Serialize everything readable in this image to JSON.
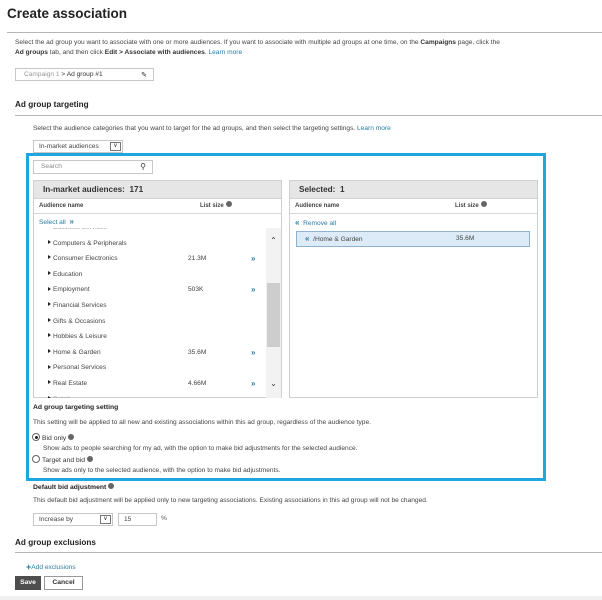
{
  "page": {
    "title": "Create association",
    "intro": {
      "part1": "Select the ad group you want to associate with one or more audiences. If you want to associate with multiple ad groups at one time, on the ",
      "campaigns": "Campaigns",
      "part2": " page, click the",
      "ad_groups": "Ad groups",
      "part3": " tab, and then click ",
      "edit_path": "Edit > Associate with audiences",
      "part4": ". ",
      "learn_more": "Learn more"
    },
    "ad_group_field": {
      "campaign": "Campaign 1",
      "separator": " > ",
      "ad_group": "Ad group #1",
      "edit_icon": "pencil-icon"
    }
  },
  "targeting": {
    "heading": "Ad group targeting",
    "description": "Select the audience categories that you want to target for the ad groups, and then select the targeting settings. ",
    "learn_more": "Learn more",
    "category_select": "In-market audiences",
    "search_placeholder": "Search",
    "available": {
      "title": "In-market audiences:",
      "count": "171",
      "col_name": "Audience name",
      "col_size": "List size",
      "select_all": "Select all",
      "partial_top": "Business Services",
      "items": [
        {
          "name": "Computers & Peripherals",
          "size": "",
          "addable": false
        },
        {
          "name": "Consumer Electronics",
          "size": "21.3M",
          "addable": true
        },
        {
          "name": "Education",
          "size": "",
          "addable": false
        },
        {
          "name": "Employment",
          "size": "503K",
          "addable": true
        },
        {
          "name": "Financial Services",
          "size": "",
          "addable": false
        },
        {
          "name": "Gifts & Occasions",
          "size": "",
          "addable": false
        },
        {
          "name": "Hobbies & Leisure",
          "size": "",
          "addable": false
        },
        {
          "name": "Home & Garden",
          "size": "35.6M",
          "addable": true
        },
        {
          "name": "Personal Services",
          "size": "",
          "addable": false
        },
        {
          "name": "Real Estate",
          "size": "4.66M",
          "addable": true
        }
      ],
      "partial_bottom": "Retail",
      "scroll_position": 0.55
    },
    "selected": {
      "title": "Selected:",
      "count": "1",
      "col_name": "Audience name",
      "col_size": "List size",
      "remove_all": "Remove all",
      "items": [
        {
          "name": "/Home & Garden",
          "size": "35.6M"
        }
      ]
    },
    "setting": {
      "heading": "Ad group targeting setting",
      "description": "This setting will be applied to all new and existing associations within this ad group, regardless of the audience type.",
      "options": [
        {
          "label": "Bid only",
          "desc": "Show ads to people searching for my ad, with the option to make bid adjustments for the selected audience.",
          "selected": true
        },
        {
          "label": "Target and bid",
          "desc": "Show ads only to the selected audience, with the option to make bid adjustments.",
          "selected": false
        }
      ]
    },
    "bid_adjustment": {
      "heading": "Default bid adjustment",
      "description": "This default bid adjustment will be applied only to new targeting associations. Existing associations in this ad group will not be changed.",
      "mode": "Increase by",
      "value": "15",
      "unit": "%"
    }
  },
  "exclusions": {
    "heading": "Ad group exclusions",
    "add_label": "Add exclusions"
  },
  "actions": {
    "save": "Save",
    "cancel": "Cancel"
  },
  "colors": {
    "highlight_border": "#1ea6df",
    "link": "#2a7ba0",
    "selected_row_bg": "#dcebf7"
  }
}
